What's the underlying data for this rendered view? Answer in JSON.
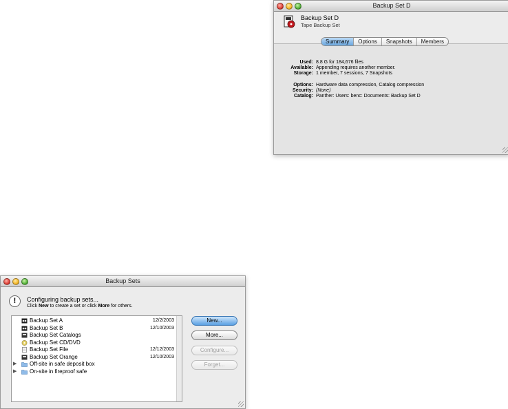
{
  "set_window": {
    "title": "Backup Set D",
    "name": "Backup Set D",
    "type": "Tape Backup Set",
    "tabs": [
      {
        "label": "Summary"
      },
      {
        "label": "Options"
      },
      {
        "label": "Snapshots"
      },
      {
        "label": "Members"
      }
    ],
    "summary": {
      "used_label": "Used:",
      "used_value": "8.8 G for 184,676 files",
      "available_label": "Available:",
      "available_value": "Appending requires another member.",
      "storage_label": "Storage:",
      "storage_value": "1 member, 7 sessions, 7 Snapshots",
      "options_label": "Options:",
      "options_value": "Hardware data compression, Catalog compression",
      "security_label": "Security:",
      "security_value": "(None)",
      "catalog_label": "Catalog:",
      "catalog_value": "Panther: Users: benc: Documents: Backup Set D"
    }
  },
  "sets_window": {
    "title": "Backup Sets",
    "headline": "Configuring backup sets...",
    "sub_pre": "Click ",
    "sub_new": "New",
    "sub_mid": " to create a set or click ",
    "sub_more": "More",
    "sub_post": " for others.",
    "items": [
      {
        "name": "Backup Set A",
        "date": "12/2/2003"
      },
      {
        "name": "Backup Set B",
        "date": "12/10/2003"
      },
      {
        "name": "Backup Set Catalogs",
        "date": ""
      },
      {
        "name": "Backup Set CD/DVD",
        "date": ""
      },
      {
        "name": "Backup Set File",
        "date": "12/12/2003"
      },
      {
        "name": "Backup Set Orange",
        "date": "12/10/2003"
      },
      {
        "name": "Off-site in safe deposit box",
        "date": ""
      },
      {
        "name": "On-site in fireproof safe",
        "date": ""
      }
    ],
    "buttons": {
      "new": "New...",
      "more": "More...",
      "configure": "Configure...",
      "forget": "Forget..."
    }
  }
}
